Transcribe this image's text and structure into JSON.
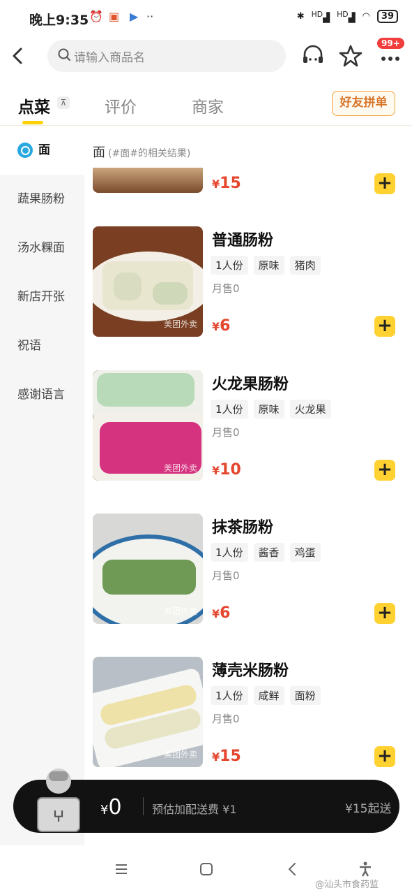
{
  "status_bar": {
    "time": "晚上9:35",
    "signal_label_1": "HD",
    "signal_label_2": "HD",
    "battery": "39"
  },
  "header": {
    "search_placeholder": "请输入商品名",
    "cart_badge": "99+"
  },
  "tabs": [
    {
      "label": "点菜",
      "active": true
    },
    {
      "label": "评价",
      "active": false
    },
    {
      "label": "商家",
      "active": false
    }
  ],
  "friend_order_button": "好友拼单",
  "sidebar": {
    "items": [
      {
        "label": "面",
        "active": true,
        "icon": "search-icon"
      },
      {
        "label": "蔬果肠粉"
      },
      {
        "label": "汤水粿面"
      },
      {
        "label": "新店开张"
      },
      {
        "label": "祝语"
      },
      {
        "label": "感谢语言"
      }
    ]
  },
  "results": {
    "keyword": "面",
    "subtitle": "(#面#的相关结果)"
  },
  "partial_item": {
    "price_symbol": "¥",
    "price": "15"
  },
  "items": [
    {
      "name": "普通肠粉",
      "tags": [
        "1人份",
        "原味",
        "猪肉"
      ],
      "sold": "月售0",
      "price_symbol": "¥",
      "price": "6"
    },
    {
      "name": "火龙果肠粉",
      "tags": [
        "1人份",
        "原味",
        "火龙果"
      ],
      "sold": "月售0",
      "price_symbol": "¥",
      "price": "10"
    },
    {
      "name": "抹茶肠粉",
      "tags": [
        "1人份",
        "酱香",
        "鸡蛋"
      ],
      "sold": "月售0",
      "price_symbol": "¥",
      "price": "6"
    },
    {
      "name": "薄壳米肠粉",
      "tags": [
        "1人份",
        "咸鲜",
        "面粉"
      ],
      "sold": "月售0",
      "price_symbol": "¥",
      "price": "15"
    }
  ],
  "cart": {
    "price_symbol": "¥",
    "total": "0",
    "delivery_fee": "预估加配送费 ¥1",
    "minimum": "¥15起送"
  },
  "watermark": "美团外卖",
  "corner_watermark": "@汕头市食药监",
  "colors": {
    "accent": "#ffd100",
    "price": "#e5462e",
    "friend_button": "#d8762a"
  }
}
